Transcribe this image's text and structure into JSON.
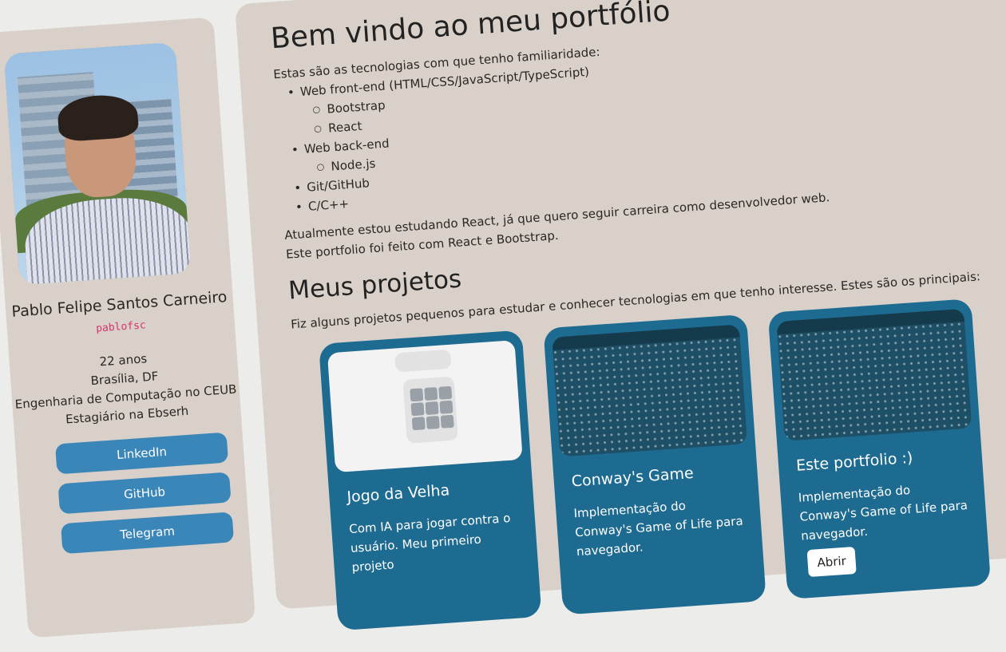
{
  "profile": {
    "photo_alt": "Profile photo",
    "name": "Pablo Felipe Santos Carneiro",
    "handle": "pablofsc",
    "info": [
      "22 anos",
      "Brasília, DF",
      "Engenharia de Computação no CEUB",
      "Estagiário na Ebserh"
    ],
    "links": [
      {
        "label": "LinkedIn"
      },
      {
        "label": "GitHub"
      },
      {
        "label": "Telegram"
      }
    ]
  },
  "main": {
    "title": "Bem vindo ao meu portfólio",
    "intro": "Estas são as tecnologias com que tenho familiaridade:",
    "techs": {
      "web_front": "Web front-end (HTML/CSS/JavaScript/TypeScript)",
      "bootstrap": "Bootstrap",
      "react": "React",
      "web_back": "Web back-end",
      "node": "Node.js",
      "git": "Git/GitHub",
      "c": "C/C++"
    },
    "studying": "Atualmente estou estudando React, já que quero seguir carreira como desenvolvedor web.",
    "built_with": "Este portfolio foi feito com React e Bootstrap.",
    "projects_title": "Meus projetos",
    "projects_intro": "Fiz alguns projetos pequenos para estudar e conhecer tecnologias em que tenho interesse. Estes são os principais:",
    "projects": [
      {
        "title": "Jogo da Velha",
        "text": "Com IA para jogar contra o usuário. Meu primeiro projeto"
      },
      {
        "title": "Conway's Game",
        "text": "Implementação do Conway's Game of Life para navegador."
      },
      {
        "title": "Este portfolio :)",
        "text": "Implementação do Conway's Game of Life para navegador.",
        "button": "Abrir"
      }
    ]
  },
  "colors": {
    "background": "#d9d1c9",
    "accent_button": "#3b86b9",
    "card": "#1e6b92",
    "handle": "#d6336c"
  }
}
